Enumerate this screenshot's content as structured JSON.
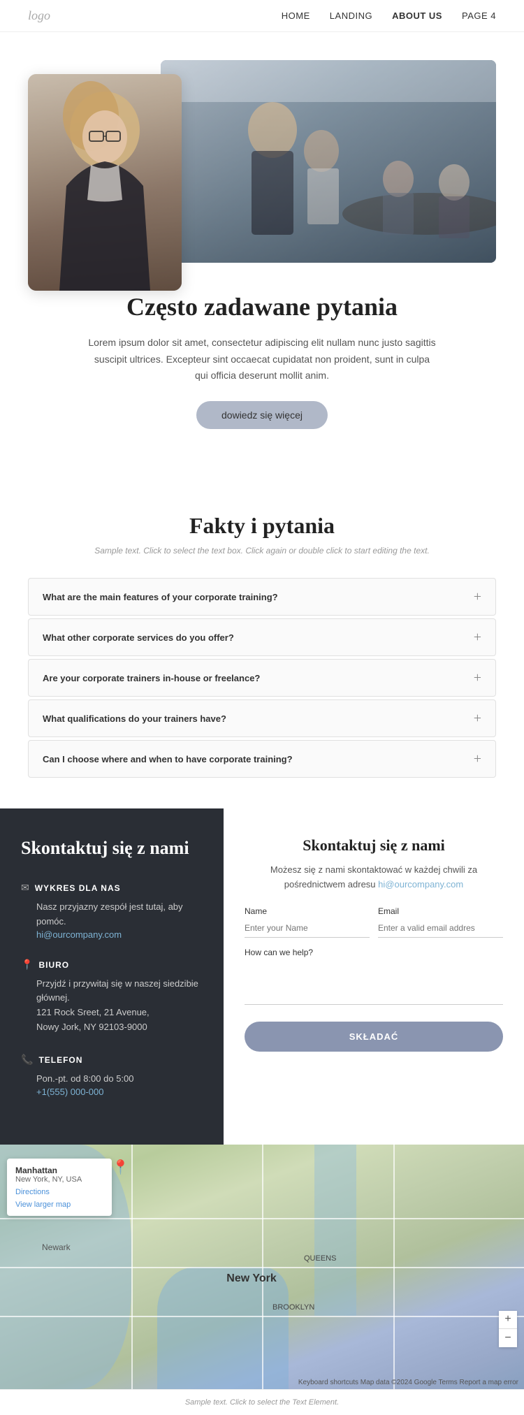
{
  "nav": {
    "logo": "logo",
    "links": [
      {
        "label": "HOME",
        "active": false
      },
      {
        "label": "LANDING",
        "active": false
      },
      {
        "label": "ABOUT US",
        "active": true
      },
      {
        "label": "PAGE 4",
        "active": false
      }
    ]
  },
  "hero": {
    "title": "Często zadawane pytania",
    "description": "Lorem ipsum dolor sit amet, consectetur adipiscing elit nullam nunc justo sagittis suscipit ultrices. Excepteur sint occaecat cupidatat non proident, sunt in culpa qui officia deserunt mollit anim.",
    "button_label": "dowiedz się więcej"
  },
  "faq_section": {
    "title": "Fakty i pytania",
    "subtitle": "Sample text. Click to select the text box. Click again or double click to start editing the text.",
    "items": [
      {
        "question": "What are the main features of your corporate training?"
      },
      {
        "question": "What other corporate services do you offer?"
      },
      {
        "question": "Are your corporate trainers in-house or freelance?"
      },
      {
        "question": "What qualifications do your trainers have?"
      },
      {
        "question": "Can I choose where and when to have corporate training?"
      }
    ]
  },
  "contact_left": {
    "title": "Skontaktuj się z nami",
    "blocks": [
      {
        "icon": "✉",
        "label": "WYKRES DLA NAS",
        "text": "Nasz przyjazny zespół jest tutaj, aby pomóc.",
        "link": "hi@ourcompany.com"
      },
      {
        "icon": "📍",
        "label": "BIURO",
        "text": "Przyjdź i przywitaj się w naszej siedzibie głównej.\n121 Rock Sreet, 21 Avenue,\nNowy Jork, NY 92103-9000",
        "link": null
      },
      {
        "icon": "📞",
        "label": "TELEFON",
        "text": "Pon.-pt. od 8:00 do 5:00",
        "link": "+1(555) 000-000"
      }
    ]
  },
  "contact_right": {
    "title": "Skontaktuj się z nami",
    "description": "Możesz się z nami skontaktować w każdej chwili za pośrednictwem adresu",
    "email_link": "hi@ourcompany.com",
    "fields": {
      "name_label": "Name",
      "name_placeholder": "Enter your Name",
      "email_label": "Email",
      "email_placeholder": "Enter a valid email addres",
      "help_label": "How can we help?",
      "help_placeholder": ""
    },
    "submit_label": "SKŁADAĆ"
  },
  "map": {
    "location_title": "Manhattan",
    "location_subtitle": "New York, NY, USA",
    "directions_label": "Directions",
    "larger_map_label": "View larger map",
    "labels": {
      "ny": "New York",
      "newark": "Newark",
      "brooklyn": "BROOKLYN",
      "queens": "QUEENS"
    },
    "attribution": "Keyboard shortcuts  Map data ©2024 Google  Terms  Report a map error"
  },
  "footer": {
    "text": "Sample text. Click to select the Text Element."
  }
}
